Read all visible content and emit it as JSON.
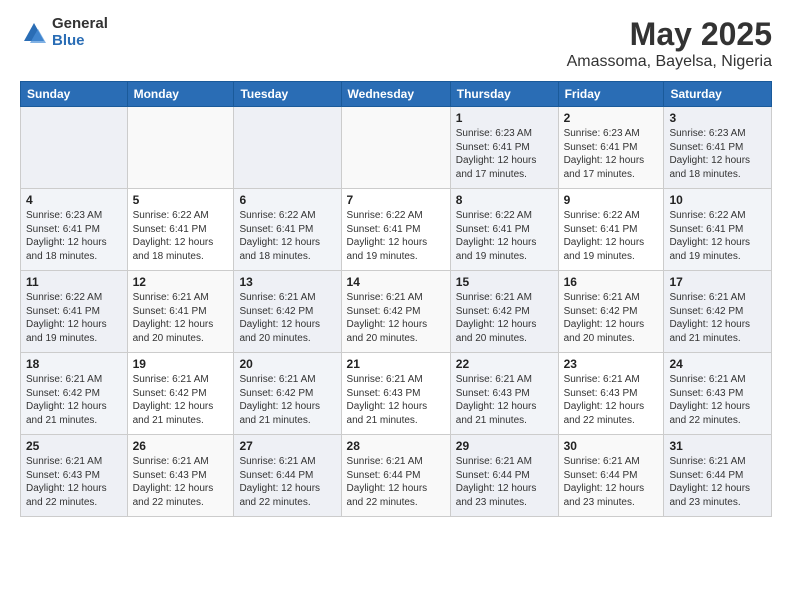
{
  "header": {
    "logo_general": "General",
    "logo_blue": "Blue",
    "title": "May 2025",
    "subtitle": "Amassoma, Bayelsa, Nigeria"
  },
  "calendar": {
    "days_of_week": [
      "Sunday",
      "Monday",
      "Tuesday",
      "Wednesday",
      "Thursday",
      "Friday",
      "Saturday"
    ],
    "weeks": [
      [
        {
          "day": "",
          "info": ""
        },
        {
          "day": "",
          "info": ""
        },
        {
          "day": "",
          "info": ""
        },
        {
          "day": "",
          "info": ""
        },
        {
          "day": "1",
          "info": "Sunrise: 6:23 AM\nSunset: 6:41 PM\nDaylight: 12 hours\nand 17 minutes."
        },
        {
          "day": "2",
          "info": "Sunrise: 6:23 AM\nSunset: 6:41 PM\nDaylight: 12 hours\nand 17 minutes."
        },
        {
          "day": "3",
          "info": "Sunrise: 6:23 AM\nSunset: 6:41 PM\nDaylight: 12 hours\nand 18 minutes."
        }
      ],
      [
        {
          "day": "4",
          "info": "Sunrise: 6:23 AM\nSunset: 6:41 PM\nDaylight: 12 hours\nand 18 minutes."
        },
        {
          "day": "5",
          "info": "Sunrise: 6:22 AM\nSunset: 6:41 PM\nDaylight: 12 hours\nand 18 minutes."
        },
        {
          "day": "6",
          "info": "Sunrise: 6:22 AM\nSunset: 6:41 PM\nDaylight: 12 hours\nand 18 minutes."
        },
        {
          "day": "7",
          "info": "Sunrise: 6:22 AM\nSunset: 6:41 PM\nDaylight: 12 hours\nand 19 minutes."
        },
        {
          "day": "8",
          "info": "Sunrise: 6:22 AM\nSunset: 6:41 PM\nDaylight: 12 hours\nand 19 minutes."
        },
        {
          "day": "9",
          "info": "Sunrise: 6:22 AM\nSunset: 6:41 PM\nDaylight: 12 hours\nand 19 minutes."
        },
        {
          "day": "10",
          "info": "Sunrise: 6:22 AM\nSunset: 6:41 PM\nDaylight: 12 hours\nand 19 minutes."
        }
      ],
      [
        {
          "day": "11",
          "info": "Sunrise: 6:22 AM\nSunset: 6:41 PM\nDaylight: 12 hours\nand 19 minutes."
        },
        {
          "day": "12",
          "info": "Sunrise: 6:21 AM\nSunset: 6:41 PM\nDaylight: 12 hours\nand 20 minutes."
        },
        {
          "day": "13",
          "info": "Sunrise: 6:21 AM\nSunset: 6:42 PM\nDaylight: 12 hours\nand 20 minutes."
        },
        {
          "day": "14",
          "info": "Sunrise: 6:21 AM\nSunset: 6:42 PM\nDaylight: 12 hours\nand 20 minutes."
        },
        {
          "day": "15",
          "info": "Sunrise: 6:21 AM\nSunset: 6:42 PM\nDaylight: 12 hours\nand 20 minutes."
        },
        {
          "day": "16",
          "info": "Sunrise: 6:21 AM\nSunset: 6:42 PM\nDaylight: 12 hours\nand 20 minutes."
        },
        {
          "day": "17",
          "info": "Sunrise: 6:21 AM\nSunset: 6:42 PM\nDaylight: 12 hours\nand 21 minutes."
        }
      ],
      [
        {
          "day": "18",
          "info": "Sunrise: 6:21 AM\nSunset: 6:42 PM\nDaylight: 12 hours\nand 21 minutes."
        },
        {
          "day": "19",
          "info": "Sunrise: 6:21 AM\nSunset: 6:42 PM\nDaylight: 12 hours\nand 21 minutes."
        },
        {
          "day": "20",
          "info": "Sunrise: 6:21 AM\nSunset: 6:42 PM\nDaylight: 12 hours\nand 21 minutes."
        },
        {
          "day": "21",
          "info": "Sunrise: 6:21 AM\nSunset: 6:43 PM\nDaylight: 12 hours\nand 21 minutes."
        },
        {
          "day": "22",
          "info": "Sunrise: 6:21 AM\nSunset: 6:43 PM\nDaylight: 12 hours\nand 21 minutes."
        },
        {
          "day": "23",
          "info": "Sunrise: 6:21 AM\nSunset: 6:43 PM\nDaylight: 12 hours\nand 22 minutes."
        },
        {
          "day": "24",
          "info": "Sunrise: 6:21 AM\nSunset: 6:43 PM\nDaylight: 12 hours\nand 22 minutes."
        }
      ],
      [
        {
          "day": "25",
          "info": "Sunrise: 6:21 AM\nSunset: 6:43 PM\nDaylight: 12 hours\nand 22 minutes."
        },
        {
          "day": "26",
          "info": "Sunrise: 6:21 AM\nSunset: 6:43 PM\nDaylight: 12 hours\nand 22 minutes."
        },
        {
          "day": "27",
          "info": "Sunrise: 6:21 AM\nSunset: 6:44 PM\nDaylight: 12 hours\nand 22 minutes."
        },
        {
          "day": "28",
          "info": "Sunrise: 6:21 AM\nSunset: 6:44 PM\nDaylight: 12 hours\nand 22 minutes."
        },
        {
          "day": "29",
          "info": "Sunrise: 6:21 AM\nSunset: 6:44 PM\nDaylight: 12 hours\nand 23 minutes."
        },
        {
          "day": "30",
          "info": "Sunrise: 6:21 AM\nSunset: 6:44 PM\nDaylight: 12 hours\nand 23 minutes."
        },
        {
          "day": "31",
          "info": "Sunrise: 6:21 AM\nSunset: 6:44 PM\nDaylight: 12 hours\nand 23 minutes."
        }
      ]
    ]
  }
}
